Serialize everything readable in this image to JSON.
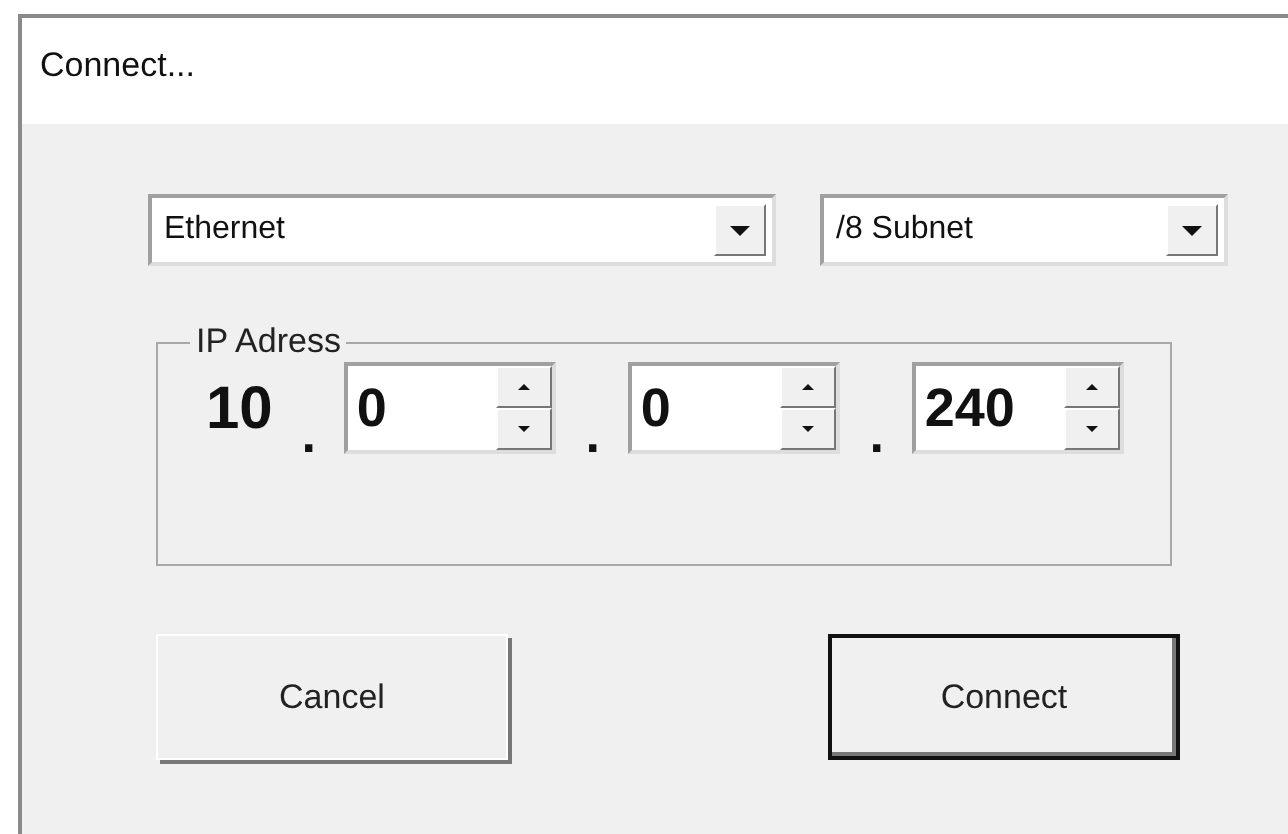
{
  "window": {
    "title": "Connect..."
  },
  "network_select": {
    "value": "Ethernet"
  },
  "subnet_select": {
    "value": "/8 Subnet"
  },
  "ip_address": {
    "label": "IP Adress",
    "first_octet": "10",
    "separators": [
      ".",
      ".",
      "."
    ],
    "octets": [
      {
        "value": "0"
      },
      {
        "value": "0"
      },
      {
        "value": "240"
      }
    ]
  },
  "buttons": [
    {
      "label": "Cancel",
      "default": false
    },
    {
      "label": "Connect",
      "default": true
    }
  ]
}
